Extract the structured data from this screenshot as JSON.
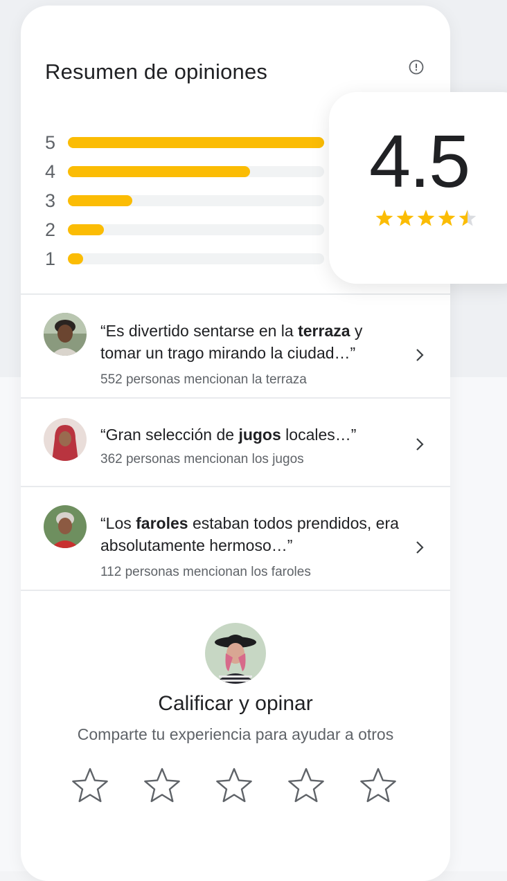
{
  "summary": {
    "title": "Resumen de opiniones",
    "rating": "4.5",
    "rating_value": 4.5,
    "max_rating": 5,
    "accent_color": "#fbbc04",
    "bars": [
      {
        "label": "5",
        "fraction": 1.0
      },
      {
        "label": "4",
        "fraction": 0.71
      },
      {
        "label": "3",
        "fraction": 0.25
      },
      {
        "label": "2",
        "fraction": 0.14
      },
      {
        "label": "1",
        "fraction": 0.06
      }
    ]
  },
  "reviews": [
    {
      "quote_pre": "“Es divertido sentarse en la ",
      "quote_bold": "terraza",
      "quote_post": " y tomar un trago mirando la ciudad…”",
      "mentions": "552 personas mencionan la terraza"
    },
    {
      "quote_pre": "“Gran selección de ",
      "quote_bold": "jugos",
      "quote_post": " locales…”",
      "mentions": "362 personas mencionan los jugos"
    },
    {
      "quote_pre": "“Los ",
      "quote_bold": "faroles",
      "quote_post": " estaban todos prendidos, era absolutamente hermoso…”",
      "mentions": "112 personas mencionan los faroles"
    }
  ],
  "rate": {
    "title": "Calificar y opinar",
    "subtitle": "Comparte tu experiencia para ayudar a otros",
    "star_count": 5
  }
}
